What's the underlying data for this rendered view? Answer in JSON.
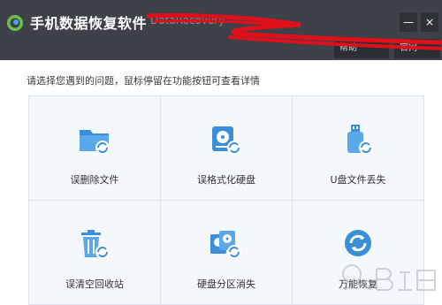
{
  "app": {
    "title": "手机数据恢复软件",
    "subtitle": "DataRecovery"
  },
  "window": {
    "minimize_label": "—",
    "close_label": "×"
  },
  "toolbar": {
    "button_a_label": "帮助",
    "button_b_label": "官网"
  },
  "main": {
    "instruction": "请选择您遇到的问题，鼠标停留在功能按钮可查看详情"
  },
  "options": [
    {
      "label": "误删除文件",
      "icon": "folder-recover-icon"
    },
    {
      "label": "误格式化硬盘",
      "icon": "disk-recover-icon"
    },
    {
      "label": "U盘文件丢失",
      "icon": "usb-recover-icon"
    },
    {
      "label": "误清空回收站",
      "icon": "recycle-bin-recover-icon"
    },
    {
      "label": "硬盘分区消失",
      "icon": "partition-recover-icon"
    },
    {
      "label": "万能恢复",
      "icon": "universal-recover-icon"
    }
  ],
  "colors": {
    "titlebar": "#3e4147",
    "accent": "#3a8fd8",
    "scribble": "#e0101a",
    "cell_bg": "#f4f7fc"
  }
}
